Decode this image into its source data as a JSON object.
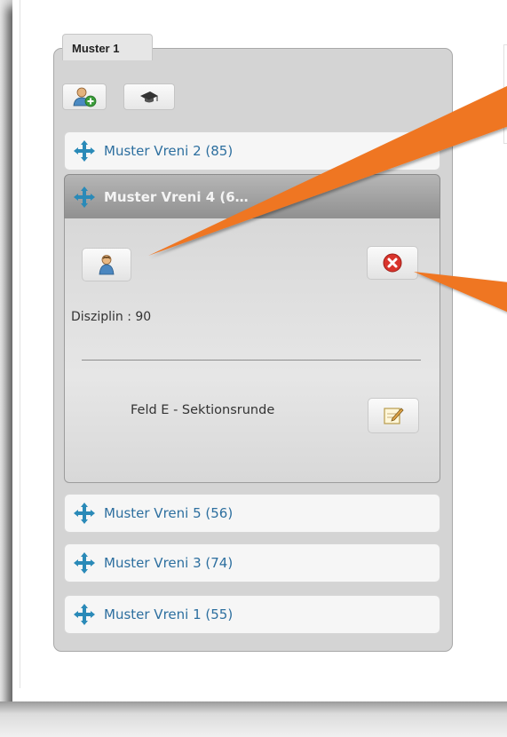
{
  "tab": {
    "label": "Muster 1"
  },
  "toolbar": {
    "add_member_icon": "user-add-icon",
    "hat_icon": "graduation-cap-icon"
  },
  "entries": [
    {
      "label": "Muster Vreni 2 (85)",
      "expanded": false
    },
    {
      "label": "Muster Vreni 4 (6…",
      "expanded": true
    },
    {
      "label": "Muster Vreni 5 (56)",
      "expanded": false
    },
    {
      "label": "Muster Vreni 3 (74)",
      "expanded": false
    },
    {
      "label": "Muster Vreni 1 (55)",
      "expanded": false
    }
  ],
  "detail": {
    "disziplin_label": "Disziplin : 90",
    "feld_label": "Feld E - Sektionsrunde",
    "profile_icon": "user-profile-icon",
    "delete_icon": "delete-circle-icon",
    "edit_icon": "edit-note-icon"
  },
  "colors": {
    "arrow": "#ef7624",
    "link": "#2d6f9f",
    "delete": "#d9342c"
  }
}
